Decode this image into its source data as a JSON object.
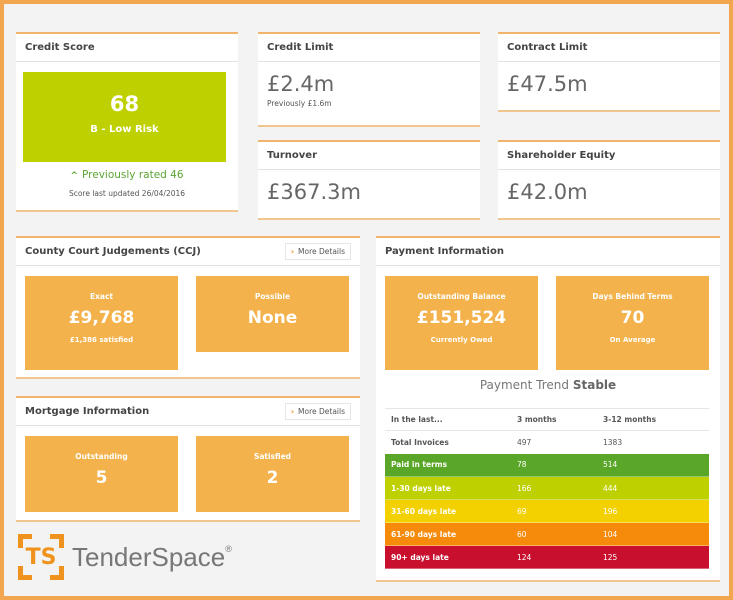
{
  "credit_score": {
    "title": "Credit Score",
    "score": "68",
    "risk": "B - Low Risk",
    "previous_icon": "chevron-up-icon",
    "previous": "Previously rated 46",
    "updated": "Score last updated 26/04/2016",
    "color": "#bfd000"
  },
  "credit_limit": {
    "title": "Credit Limit",
    "value": "£2.4m",
    "note": "Previously £1.6m"
  },
  "contract_limit": {
    "title": "Contract Limit",
    "value": "£47.5m"
  },
  "turnover": {
    "title": "Turnover",
    "value": "£367.3m"
  },
  "shareholder_equity": {
    "title": "Shareholder Equity",
    "value": "£42.0m"
  },
  "ccj": {
    "title": "County Court Judgements (CCJ)",
    "more_label": "More Details",
    "exact": {
      "label": "Exact",
      "value": "£9,768",
      "sub": "£1,386 satisfied"
    },
    "possible": {
      "label": "Possible",
      "value": "None"
    }
  },
  "mortgage": {
    "title": "Mortgage Information",
    "more_label": "More Details",
    "outstanding": {
      "label": "Outstanding",
      "value": "5"
    },
    "satisfied": {
      "label": "Satisfied",
      "value": "2"
    }
  },
  "payment": {
    "title": "Payment Information",
    "outstanding": {
      "label": "Outstanding Balance",
      "value": "£151,524",
      "sub": "Currently Owed"
    },
    "days": {
      "label": "Days Behind Terms",
      "value": "70",
      "sub": "On Average"
    },
    "trend_label": "Payment Trend",
    "trend_value": "Stable",
    "table": {
      "headers": [
        "In the last...",
        "3 months",
        "3-12 months"
      ],
      "rows": [
        {
          "label": "Total Invoices",
          "m3": "497",
          "m12": "1383",
          "color": ""
        },
        {
          "label": "Paid in terms",
          "m3": "78",
          "m12": "514",
          "color": "#5aa628"
        },
        {
          "label": "1-30 days late",
          "m3": "166",
          "m12": "444",
          "color": "#bfd000"
        },
        {
          "label": "31-60 days late",
          "m3": "69",
          "m12": "196",
          "color": "#f3d000"
        },
        {
          "label": "61-90 days late",
          "m3": "60",
          "m12": "104",
          "color": "#f68a0a"
        },
        {
          "label": "90+ days late",
          "m3": "124",
          "m12": "125",
          "color": "#c8102e"
        }
      ]
    }
  },
  "brand": {
    "mark": "TS",
    "name": "TenderSpace",
    "reg": "®",
    "color": "#f0931e"
  }
}
